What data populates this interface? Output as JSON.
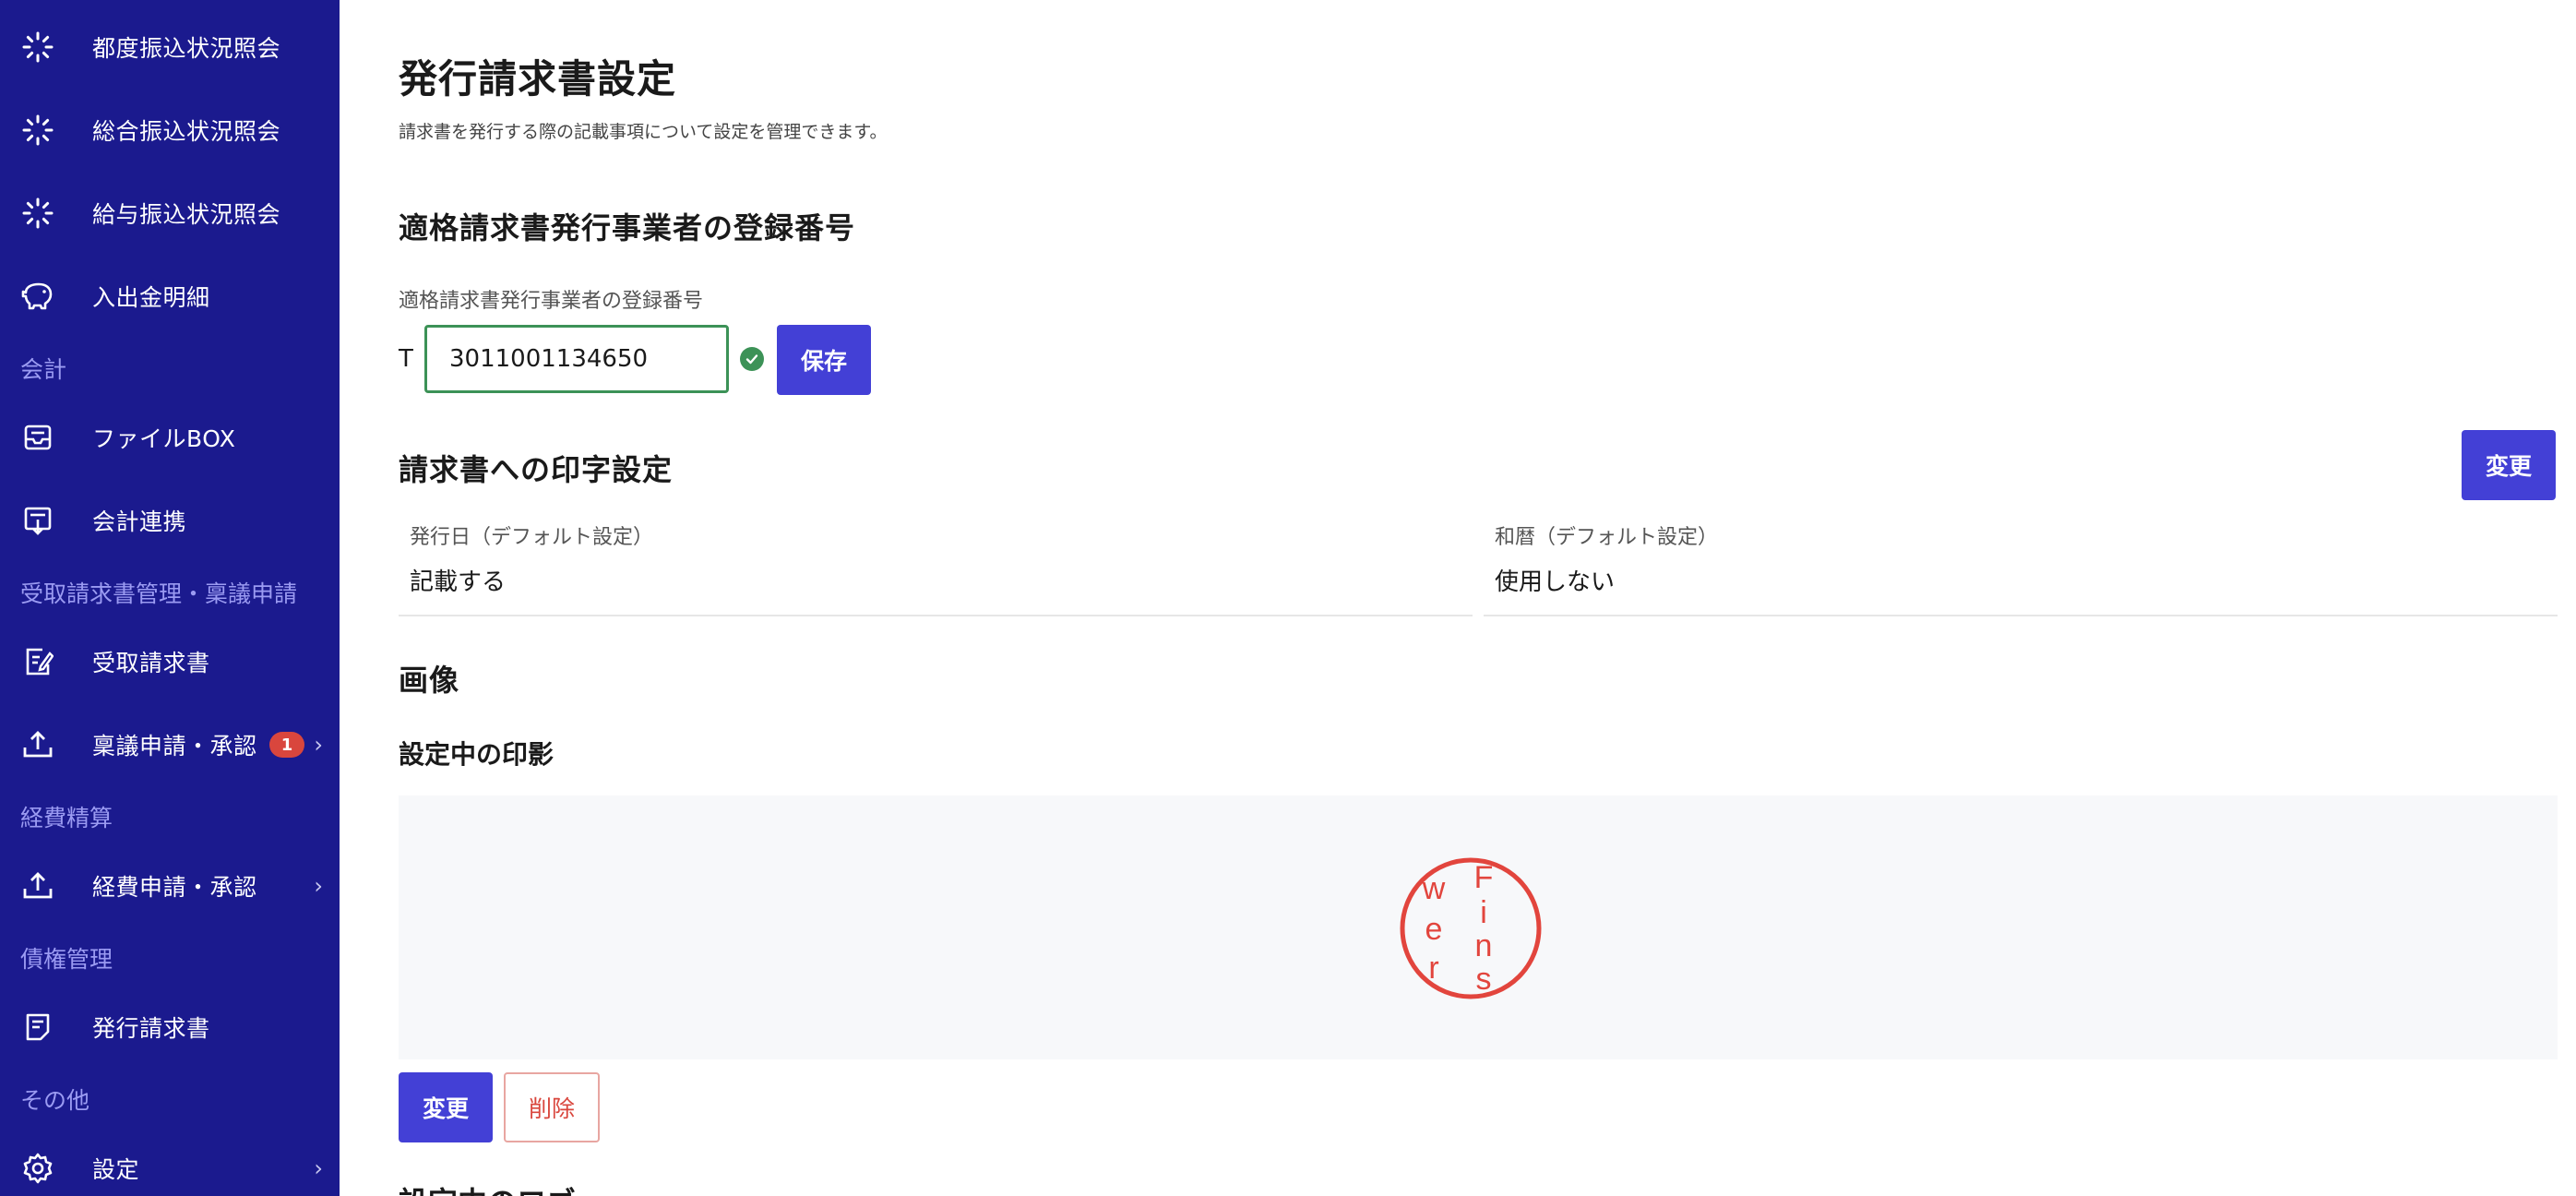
{
  "sidebar": {
    "items": [
      {
        "key": "tsudo",
        "label": "都度振込状況照会",
        "icon": "loading-spinner-icon"
      },
      {
        "key": "sogo",
        "label": "総合振込状況照会",
        "icon": "loading-spinner-icon"
      },
      {
        "key": "kyuyo",
        "label": "給与振込状況照会",
        "icon": "loading-spinner-icon"
      },
      {
        "key": "nyushukkin",
        "label": "入出金明細",
        "icon": "piggy-bank-icon"
      },
      {
        "key": "filebox",
        "label": "ファイルBOX",
        "icon": "inbox-icon"
      },
      {
        "key": "kaikei-renkei",
        "label": "会計連携",
        "icon": "receipt-download-icon"
      },
      {
        "key": "uketori",
        "label": "受取請求書",
        "icon": "document-edit-icon"
      },
      {
        "key": "ringi",
        "label": "稟議申請・承認",
        "icon": "upload-icon",
        "badge": "1",
        "chevron": "›"
      },
      {
        "key": "keihi",
        "label": "経費申請・承認",
        "icon": "upload-icon",
        "chevron": "›"
      },
      {
        "key": "hakko",
        "label": "発行請求書",
        "icon": "document-lines-icon"
      },
      {
        "key": "settei",
        "label": "設定",
        "icon": "gear-icon",
        "chevron": "›"
      }
    ],
    "sections": {
      "kaikei": "会計",
      "uketori": "受取請求書管理・稟議申請",
      "keihi": "経費精算",
      "saiken": "債権管理",
      "sonota": "その他"
    }
  },
  "main": {
    "title": "発行請求書設定",
    "description": "請求書を発行する際の記載事項について設定を管理できます。",
    "registration": {
      "heading": "適格請求書発行事業者の登録番号",
      "field_label": "適格請求書発行事業者の登録番号",
      "prefix": "T",
      "value": "3011001134650",
      "save_label": "保存"
    },
    "print_settings": {
      "heading": "請求書への印字設定",
      "change_label": "変更",
      "issue_date_label": "発行日（デフォルト設定）",
      "issue_date_value": "記載する",
      "wareki_label": "和暦（デフォルト設定）",
      "wareki_value": "使用しない"
    },
    "image": {
      "heading": "画像",
      "seal_heading": "設定中の印影",
      "seal_text_left": [
        "w",
        "e",
        "r"
      ],
      "seal_text_right": [
        "F",
        "i",
        "n",
        "s"
      ],
      "change_label": "変更",
      "delete_label": "削除",
      "logo_heading": "設定中のロゴ"
    }
  },
  "colors": {
    "sidebar_bg": "#1b1a8e",
    "section_label": "#9b9bf2",
    "primary": "#4340d6",
    "success": "#3c9257",
    "danger": "#d9463d",
    "seal_red": "#e2453d"
  }
}
